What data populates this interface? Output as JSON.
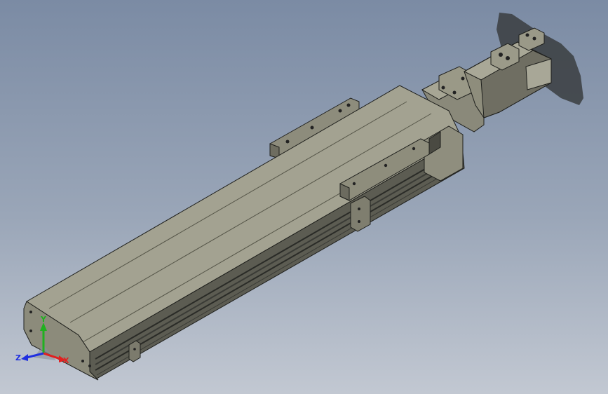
{
  "viewport": {
    "background_top": "#7b8ba4",
    "background_bottom": "#c2c8d2"
  },
  "model": {
    "body_color": "#8e8d7d",
    "top_color": "#a6a594",
    "dark_color": "#3b3c38",
    "edge_color": "#1e1f1c"
  },
  "triad": {
    "x_label": "X",
    "y_label": "Y",
    "z_label": "Z",
    "x_color": "#e02020",
    "y_color": "#20b020",
    "z_color": "#2030e0"
  }
}
